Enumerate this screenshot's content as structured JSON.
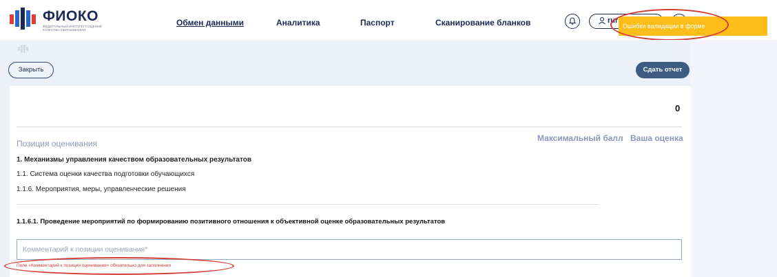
{
  "header": {
    "logo_title": "ФИОКО",
    "logo_subtitle": "ФЕДЕРАЛЬНЫЙ ИНСТИТУТ ОЦЕНКИ КАЧЕСТВА ОБРАЗОВАНИЯ",
    "nav": [
      {
        "label": "Обмен данными",
        "active": true
      },
      {
        "label": "Аналитика",
        "active": false
      },
      {
        "label": "Паспорт",
        "active": false
      },
      {
        "label": "Сканирование бланков",
        "active": false
      }
    ],
    "user_label": "rur",
    "toast": "Ошибки валидации в форме"
  },
  "toolbar": {
    "close_label": "Закрыть",
    "submit_label": "Сдать отчет"
  },
  "report": {
    "total_score": "0",
    "position_heading": "Позиция оценивания",
    "col_max": "Максимальный балл",
    "col_yours": "Ваша оценка",
    "section_1": "1. Механизмы управления качеством образовательных результатов",
    "section_1_1": "1.1. Система оценки качества подготовки обучающихся",
    "section_1_1_6": "1.1.6. Мероприятия, меры, управленческие решения",
    "criterion": "1.1.6.1. Проведение мероприятий по формированию позитивного отношения к объективной оценке образовательных результатов",
    "comment_placeholder": "Комментарий к позиции оценивания*",
    "error_text": "Поле «Комментарий к позиции оценивания» обязательно для заполнения"
  },
  "colors": {
    "brand_navy": "#1b2a55",
    "toast_bg": "#fdbd1b",
    "submit_bg": "#3e5c82",
    "error_red": "#d23a32",
    "muted_heading": "#8a98b8"
  }
}
